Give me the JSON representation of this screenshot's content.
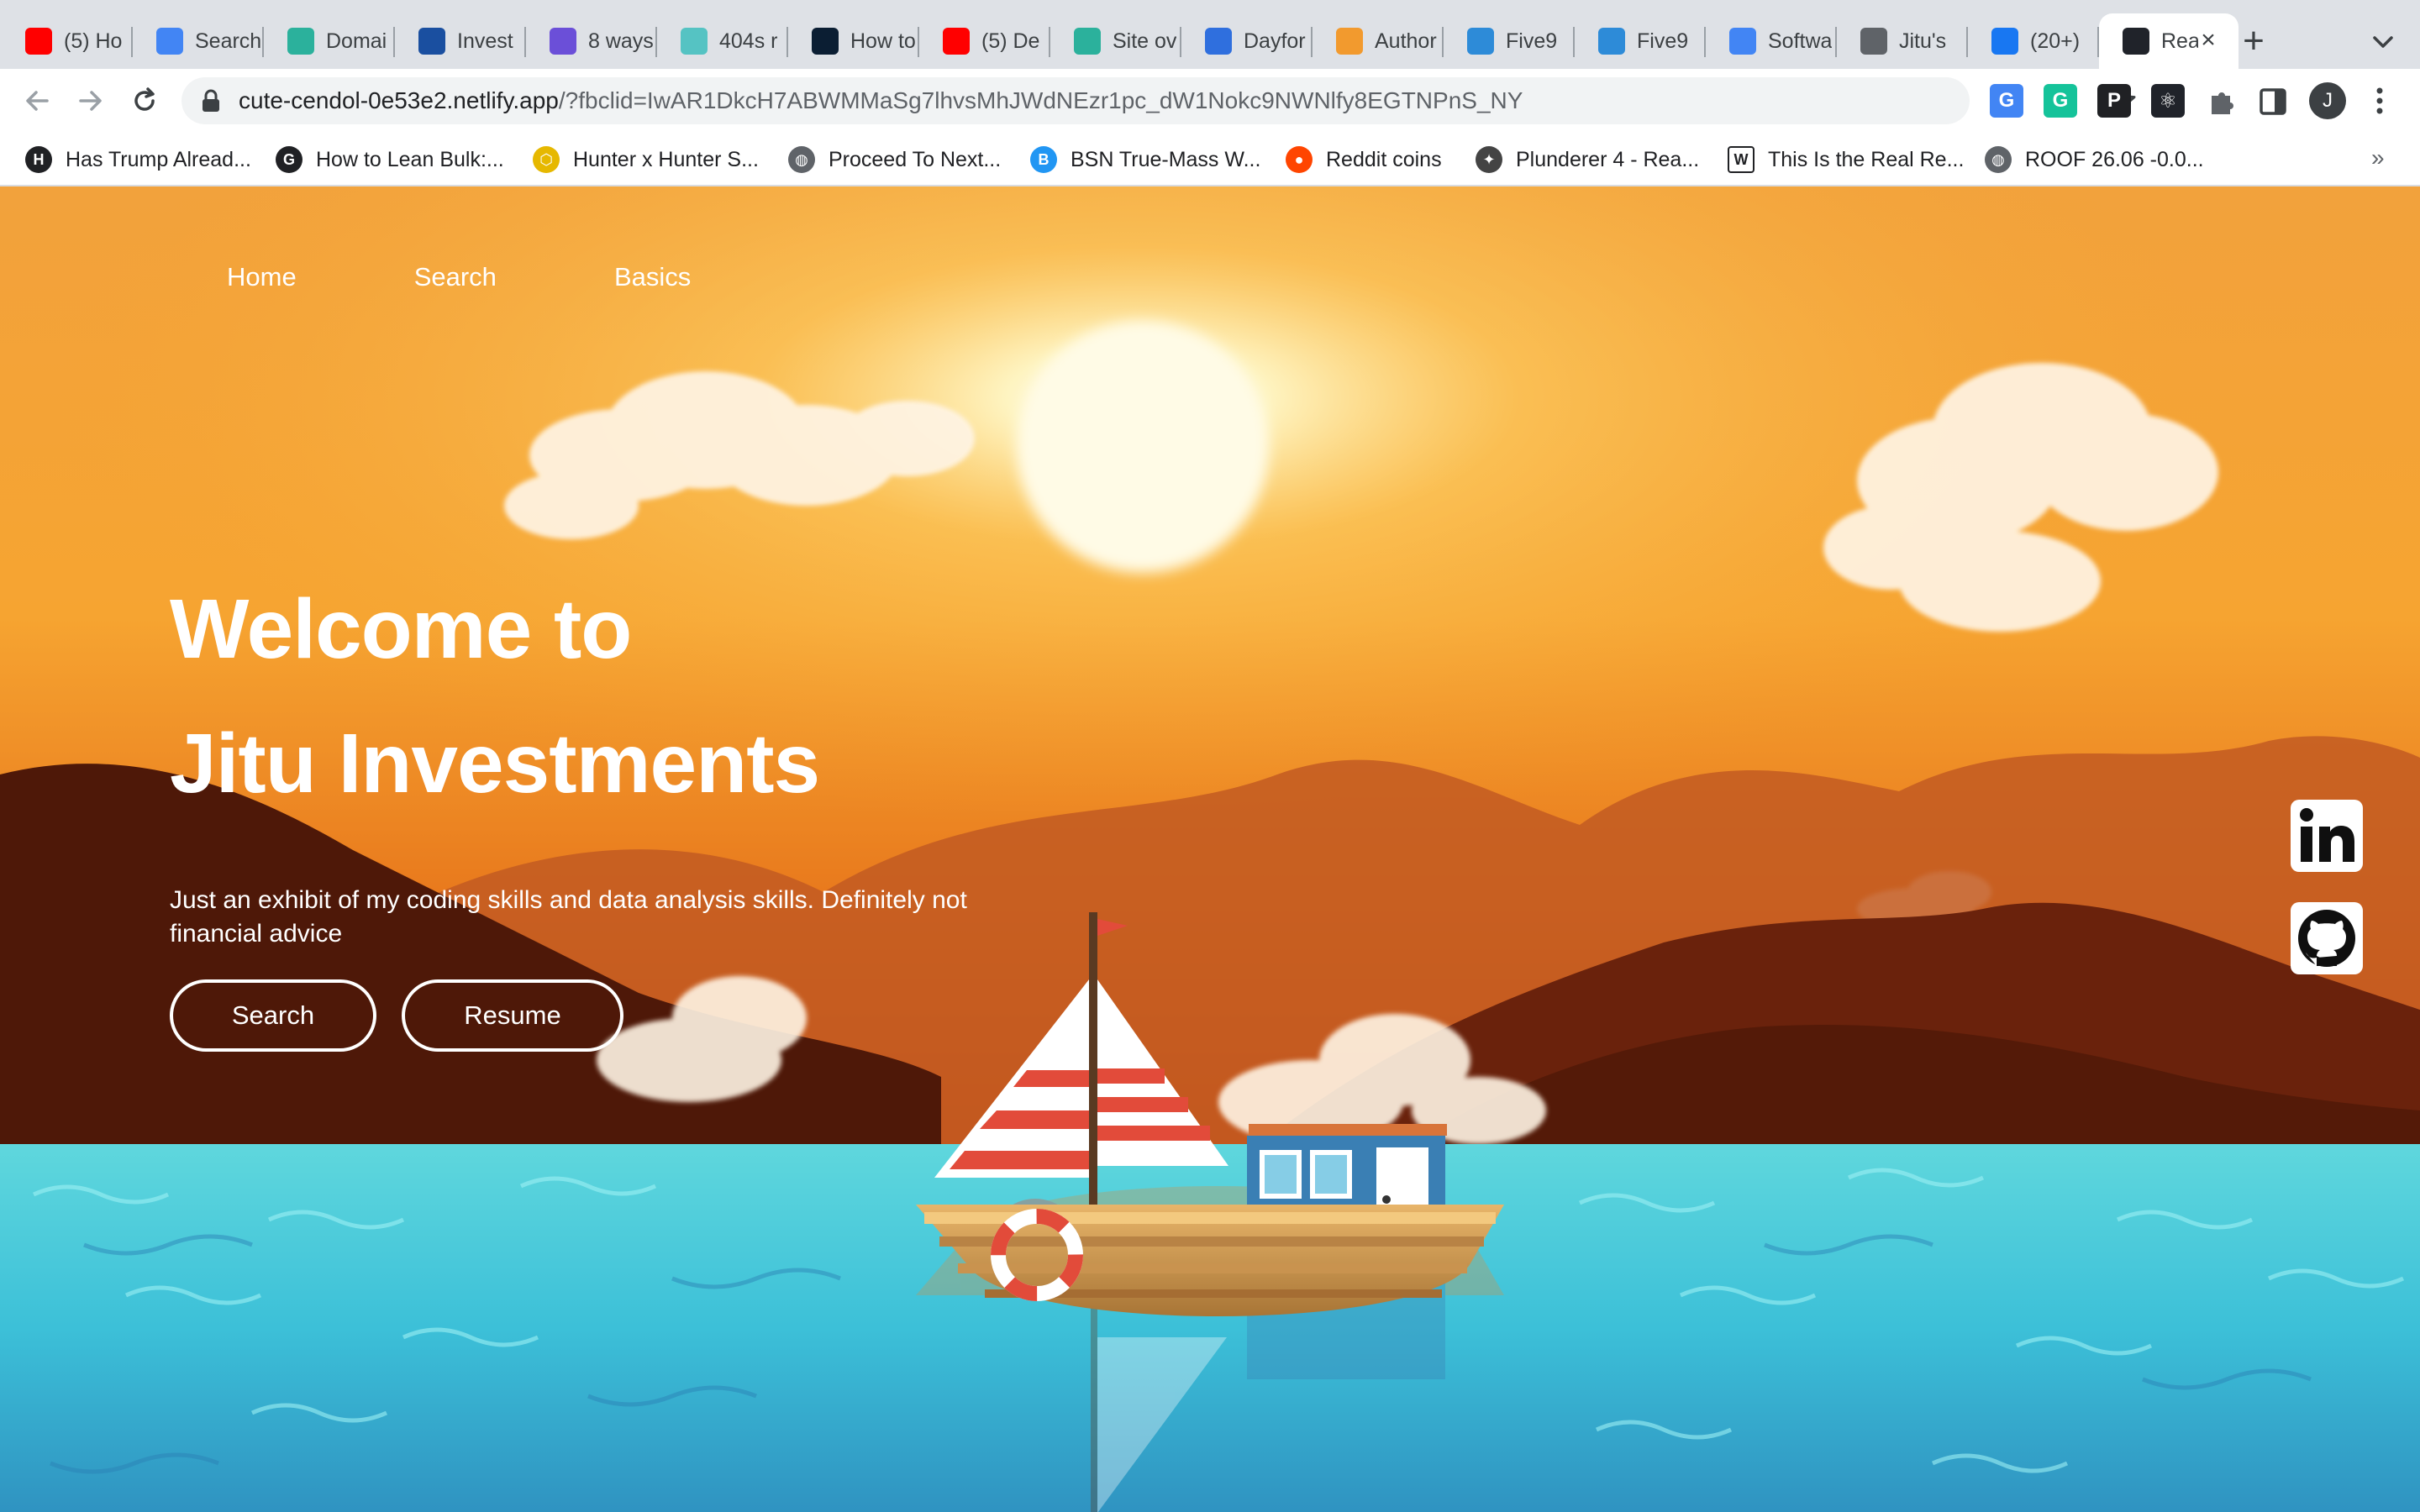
{
  "browser": {
    "tabs": [
      {
        "label": "(5) Ho",
        "icon": "youtube-icon",
        "color": "#ff0000"
      },
      {
        "label": "Search",
        "icon": "flag-icon",
        "color": "#4285f4"
      },
      {
        "label": "Domai",
        "icon": "diamond-icon",
        "color": "#2bb19c"
      },
      {
        "label": "Invest",
        "icon": "mi-logo-icon",
        "color": "#1a4fa0"
      },
      {
        "label": "8 ways",
        "icon": "rocket-icon",
        "color": "#6b4fd8"
      },
      {
        "label": "404s r",
        "icon": "gem-icon",
        "color": "#55c3c3"
      },
      {
        "label": "How to",
        "icon": "triangle-logo-icon",
        "color": "#0b1e33"
      },
      {
        "label": "(5) De",
        "icon": "youtube-icon",
        "color": "#ff0000"
      },
      {
        "label": "Site ov",
        "icon": "diamond-icon",
        "color": "#2bb19c"
      },
      {
        "label": "Dayfor",
        "icon": "dayforce-icon",
        "color": "#2f6fde"
      },
      {
        "label": "Author",
        "icon": "author-a-icon",
        "color": "#f29a2e"
      },
      {
        "label": "Five9",
        "icon": "five9-icon",
        "color": "#2d8bd8"
      },
      {
        "label": "Five9",
        "icon": "five9-icon",
        "color": "#2d8bd8"
      },
      {
        "label": "Softwa",
        "icon": "docs-icon",
        "color": "#4285f4"
      },
      {
        "label": "Jitu's",
        "icon": "globe-icon",
        "color": "#5f6368"
      },
      {
        "label": "(20+)",
        "icon": "facebook-icon",
        "color": "#1877f2"
      },
      {
        "label": "Rea",
        "icon": "react-icon",
        "color": "#20232a",
        "active": true
      }
    ],
    "new_tab": "+",
    "url_host": "cute-cendol-0e53e2.netlify.app",
    "url_rest": "/?fbclid=IwAR1DkcH7ABWMMaSg7lhvsMhJWdNEzr1pc_dW1Nokc9NWNlfy8EGTNPnS_NY",
    "profile_initial": "J",
    "extensions": [
      {
        "name": "translate-extension-icon",
        "label": "G",
        "color": "#4285f4"
      },
      {
        "name": "grammarly-extension-icon",
        "label": "G",
        "color": "#15c39a"
      },
      {
        "name": "p-extension-icon",
        "label": "P",
        "color": "#202124"
      },
      {
        "name": "react-devtools-extension-icon",
        "label": "⚛",
        "color": "#20232a"
      }
    ],
    "bookmarks": [
      {
        "label": "Has Trump Alread...",
        "icon": "h-logo-icon",
        "color": "#202124",
        "glyph": "H"
      },
      {
        "label": "How to Lean Bulk:...",
        "icon": "g-logo-icon",
        "color": "#202124",
        "glyph": "G"
      },
      {
        "label": "Hunter x Hunter S...",
        "icon": "hexagon-logo-icon",
        "color": "#e6b800",
        "glyph": "⬡"
      },
      {
        "label": "Proceed To Next...",
        "icon": "globe-icon",
        "color": "#5f6368",
        "glyph": "◍"
      },
      {
        "label": "BSN True-Mass W...",
        "icon": "bsn-logo-icon",
        "color": "#2196f3",
        "glyph": "B"
      },
      {
        "label": "Reddit coins",
        "icon": "reddit-icon",
        "color": "#ff4500",
        "glyph": "●"
      },
      {
        "label": "Plunderer 4 - Rea...",
        "icon": "anime-logo-icon",
        "color": "#444444",
        "glyph": "✦"
      },
      {
        "label": "This Is the Real Re...",
        "icon": "word-doc-icon",
        "color": "#ffffff",
        "glyph": "W"
      },
      {
        "label": "ROOF 26.06 -0.0...",
        "icon": "globe-icon",
        "color": "#5f6368",
        "glyph": "◍"
      }
    ],
    "bookmarks_more": "»"
  },
  "site": {
    "nav": [
      "Home",
      "Search",
      "Basics"
    ],
    "hero": {
      "line1": "Welcome to",
      "line2": "Jitu Investments",
      "subtitle": "Just an exhibit of my coding skills and data analysis skills. Definitely not financial advice"
    },
    "buttons": {
      "search": "Search",
      "resume": "Resume"
    },
    "social": [
      {
        "name": "linkedin-icon",
        "label": "in"
      },
      {
        "name": "github-icon"
      }
    ],
    "colors": {
      "sky_top": "#f4a33c",
      "sun": "#fff6c8",
      "water": "#4cc9d8",
      "water_deep": "#3aa0c8",
      "mountain_far": "#b84a1a",
      "mountain_near": "#5a1a08",
      "text": "#ffffff"
    }
  }
}
